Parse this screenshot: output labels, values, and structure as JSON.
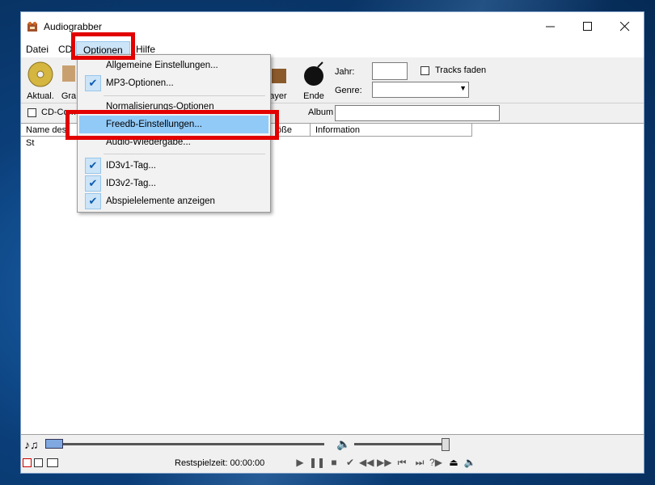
{
  "window": {
    "title": "Audiograbber"
  },
  "menubar": {
    "items": [
      "Datei",
      "CD",
      "Optionen",
      "Hilfe"
    ]
  },
  "toolbar": {
    "buttons": [
      "Aktual.",
      "Gra",
      "ayer",
      "Ende"
    ],
    "labels": {
      "year": "Jahr:",
      "genre": "Genre:",
      "tracks_fade": "Tracks faden",
      "cd_comp": "CD-Com",
      "album": "Album"
    }
  },
  "list": {
    "columns": [
      "Name des St",
      "öße",
      "Information"
    ]
  },
  "status": {
    "remaining": "Restspielzeit: 00:00:00"
  },
  "dropdown": {
    "items": [
      {
        "label": "Allgemeine Einstellungen...",
        "checked": false
      },
      {
        "label": "MP3-Optionen...",
        "checked": true
      },
      {
        "label": "Normalisierungs-Optionen",
        "checked": false
      },
      {
        "label": "Freedb-Einstellungen...",
        "checked": false,
        "highlighted": true
      },
      {
        "label": "Audio-Wiedergabe...",
        "checked": false
      },
      {
        "label": "ID3v1-Tag...",
        "checked": true
      },
      {
        "label": "ID3v2-Tag...",
        "checked": true
      },
      {
        "label": "Abspielelemente anzeigen",
        "checked": true
      }
    ]
  },
  "icons": {
    "check": "checkmark-icon",
    "play": "play-icon",
    "pause": "pause-icon",
    "stop": "stop-icon"
  }
}
